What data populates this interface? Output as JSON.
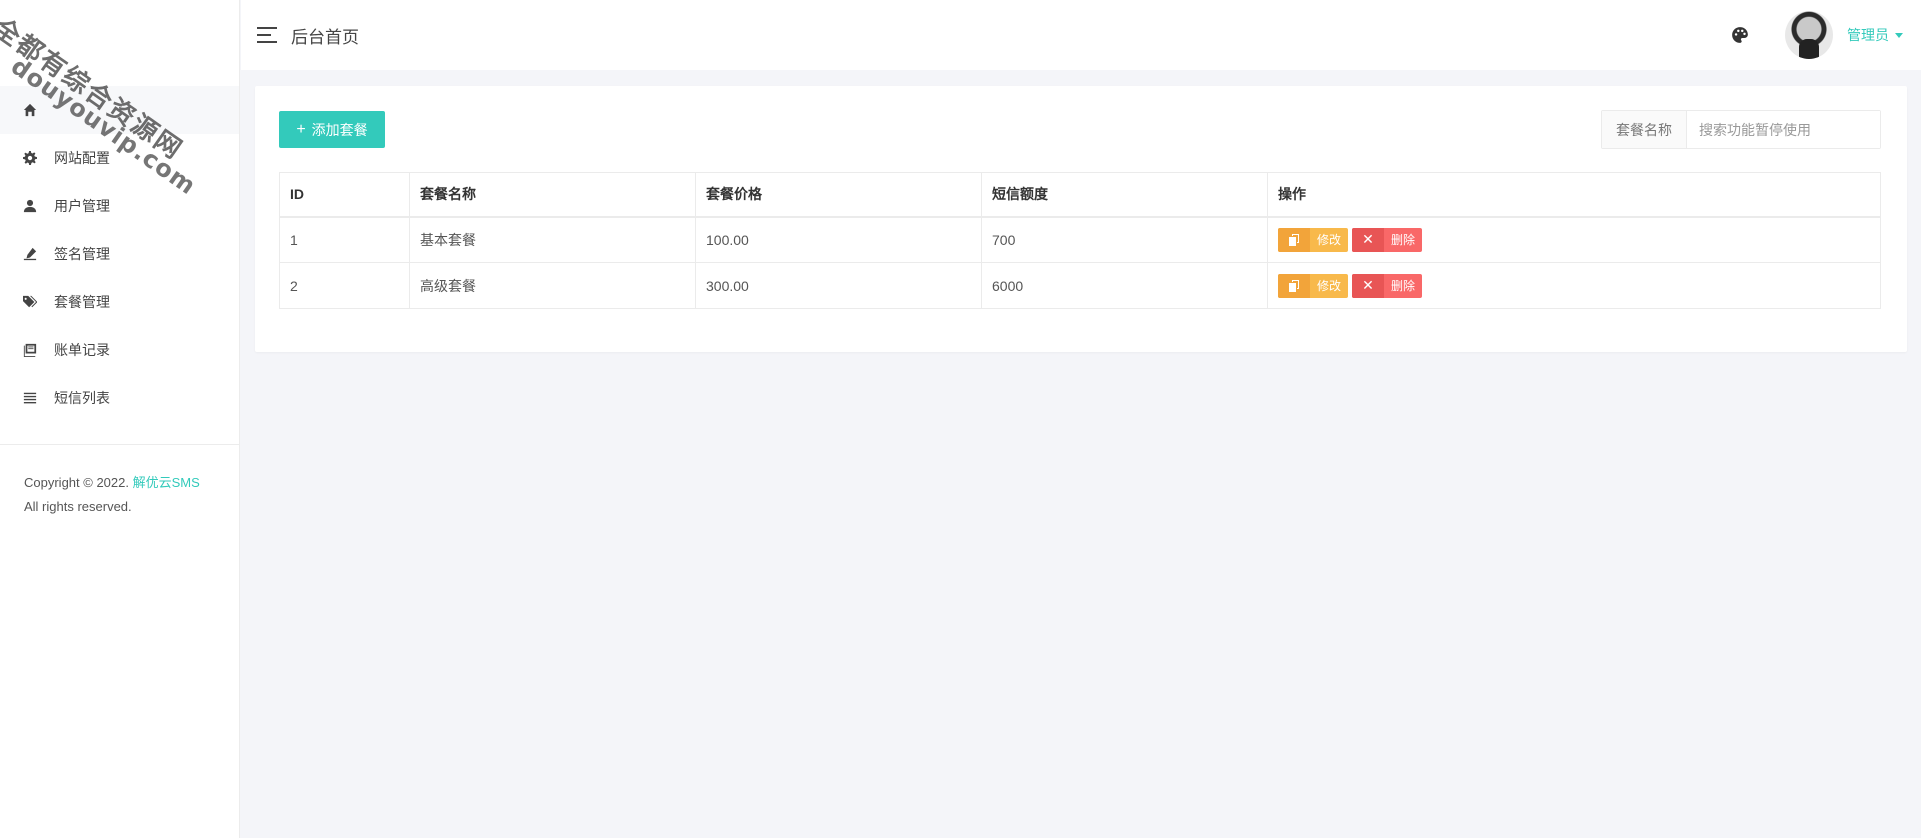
{
  "header": {
    "title": "后台首页",
    "user_name": "管理员"
  },
  "watermark": {
    "line1": "全都有综合资源网",
    "line2": "douyouvip.com"
  },
  "sidebar": {
    "items": [
      {
        "label": "",
        "icon": "home-icon"
      },
      {
        "label": "网站配置",
        "icon": "gear-icon"
      },
      {
        "label": "用户管理",
        "icon": "user-icon"
      },
      {
        "label": "签名管理",
        "icon": "signature-icon"
      },
      {
        "label": "套餐管理",
        "icon": "tags-icon"
      },
      {
        "label": "账单记录",
        "icon": "book-icon"
      },
      {
        "label": "短信列表",
        "icon": "list-icon"
      }
    ],
    "copyright_prefix": "Copyright © 2022.",
    "copyright_brand": "解优云SMS",
    "copyright_suffix": "All rights reserved."
  },
  "toolbar": {
    "add_label": "添加套餐",
    "search_label": "套餐名称",
    "search_placeholder": "搜索功能暂停使用"
  },
  "table": {
    "headers": [
      "ID",
      "套餐名称",
      "套餐价格",
      "短信额度",
      "操作"
    ],
    "rows": [
      {
        "id": "1",
        "name": "基本套餐",
        "price": "100.00",
        "quota": "700"
      },
      {
        "id": "2",
        "name": "高级套餐",
        "price": "300.00",
        "quota": "6000"
      }
    ],
    "edit_label": "修改",
    "delete_label": "删除"
  },
  "colors": {
    "accent": "#33cabb",
    "edit": "#f8b94b",
    "delete": "#f96868"
  }
}
